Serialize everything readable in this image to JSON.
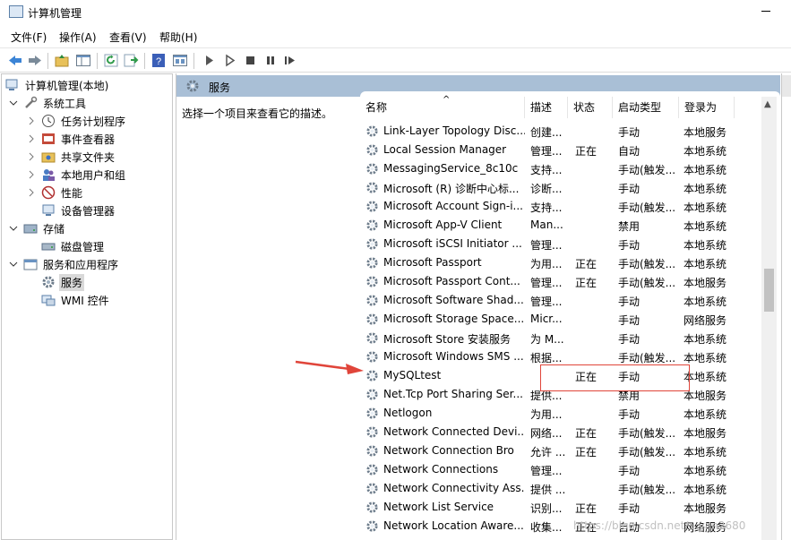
{
  "window": {
    "title": "计算机管理"
  },
  "menu": [
    "文件(F)",
    "操作(A)",
    "查看(V)",
    "帮助(H)"
  ],
  "toolbar_icons": [
    "back-arrow-icon",
    "forward-arrow-icon",
    "up-folder-icon",
    "show-hide-tree-icon",
    "refresh-icon",
    "export-list-icon",
    "help-icon",
    "properties-icon",
    "start-service-icon",
    "start-service-outline-icon",
    "stop-service-icon",
    "pause-service-icon",
    "restart-service-icon"
  ],
  "tree": {
    "root": "计算机管理(本地)",
    "system_tools": "系统工具",
    "task_scheduler": "任务计划程序",
    "event_viewer": "事件查看器",
    "shared_folders": "共享文件夹",
    "local_users": "本地用户和组",
    "performance": "性能",
    "device_manager": "设备管理器",
    "storage": "存储",
    "disk_management": "磁盘管理",
    "services_apps": "服务和应用程序",
    "services": "服务",
    "wmi": "WMI 控件"
  },
  "content": {
    "header": "服务",
    "description_hint": "选择一个项目来查看它的描述。"
  },
  "columns": {
    "name": "名称",
    "desc": "描述",
    "status": "状态",
    "startup": "启动类型",
    "logon": "登录为"
  },
  "services": [
    {
      "name": "Link-Layer Topology Disc...",
      "desc": "创建...",
      "status": "",
      "startup": "手动",
      "logon": "本地服务"
    },
    {
      "name": "Local Session Manager",
      "desc": "管理...",
      "status": "正在",
      "startup": "自动",
      "logon": "本地系统"
    },
    {
      "name": "MessagingService_8c10c",
      "desc": "支持...",
      "status": "",
      "startup": "手动(触发...",
      "logon": "本地系统"
    },
    {
      "name": "Microsoft (R) 诊断中心标...",
      "desc": "诊断...",
      "status": "",
      "startup": "手动",
      "logon": "本地系统"
    },
    {
      "name": "Microsoft Account Sign-i...",
      "desc": "支持...",
      "status": "",
      "startup": "手动(触发...",
      "logon": "本地系统"
    },
    {
      "name": "Microsoft App-V Client",
      "desc": "Man...",
      "status": "",
      "startup": "禁用",
      "logon": "本地系统"
    },
    {
      "name": "Microsoft iSCSI Initiator ...",
      "desc": "管理...",
      "status": "",
      "startup": "手动",
      "logon": "本地系统"
    },
    {
      "name": "Microsoft Passport",
      "desc": "为用...",
      "status": "正在",
      "startup": "手动(触发...",
      "logon": "本地系统"
    },
    {
      "name": "Microsoft Passport Cont...",
      "desc": "管理...",
      "status": "正在",
      "startup": "手动(触发...",
      "logon": "本地服务"
    },
    {
      "name": "Microsoft Software Shad...",
      "desc": "管理...",
      "status": "",
      "startup": "手动",
      "logon": "本地系统"
    },
    {
      "name": "Microsoft Storage Space...",
      "desc": "Micr...",
      "status": "",
      "startup": "手动",
      "logon": "网络服务"
    },
    {
      "name": "Microsoft Store 安装服务",
      "desc": "为 M...",
      "status": "",
      "startup": "手动",
      "logon": "本地系统"
    },
    {
      "name": "Microsoft Windows SMS ...",
      "desc": "根据...",
      "status": "",
      "startup": "手动(触发...",
      "logon": "本地系统"
    },
    {
      "name": "MySQLtest",
      "desc": "",
      "status": "正在",
      "startup": "手动",
      "logon": "本地系统"
    },
    {
      "name": "Net.Tcp Port Sharing Ser...",
      "desc": "提供...",
      "status": "",
      "startup": "禁用",
      "logon": "本地服务"
    },
    {
      "name": "Netlogon",
      "desc": "为用...",
      "status": "",
      "startup": "手动",
      "logon": "本地系统"
    },
    {
      "name": "Network Connected Devi...",
      "desc": "网络...",
      "status": "正在",
      "startup": "手动(触发...",
      "logon": "本地服务"
    },
    {
      "name": "Network Connection Bro",
      "desc": "允许 ...",
      "status": "正在",
      "startup": "手动(触发...",
      "logon": "本地系统"
    },
    {
      "name": "Network Connections",
      "desc": "管理...",
      "status": "",
      "startup": "手动",
      "logon": "本地系统"
    },
    {
      "name": "Network Connectivity Ass...",
      "desc": "提供 ...",
      "status": "",
      "startup": "手动(触发...",
      "logon": "本地系统"
    },
    {
      "name": "Network List Service",
      "desc": "识别...",
      "status": "正在",
      "startup": "手动",
      "logon": "本地服务"
    },
    {
      "name": "Network Location Aware...",
      "desc": "收集...",
      "status": "正在",
      "startup": "自动",
      "logon": "网络服务"
    }
  ],
  "annotation": {
    "color": "#e0453a"
  },
  "watermark": "https://blog.csdn.net/...yan2680"
}
